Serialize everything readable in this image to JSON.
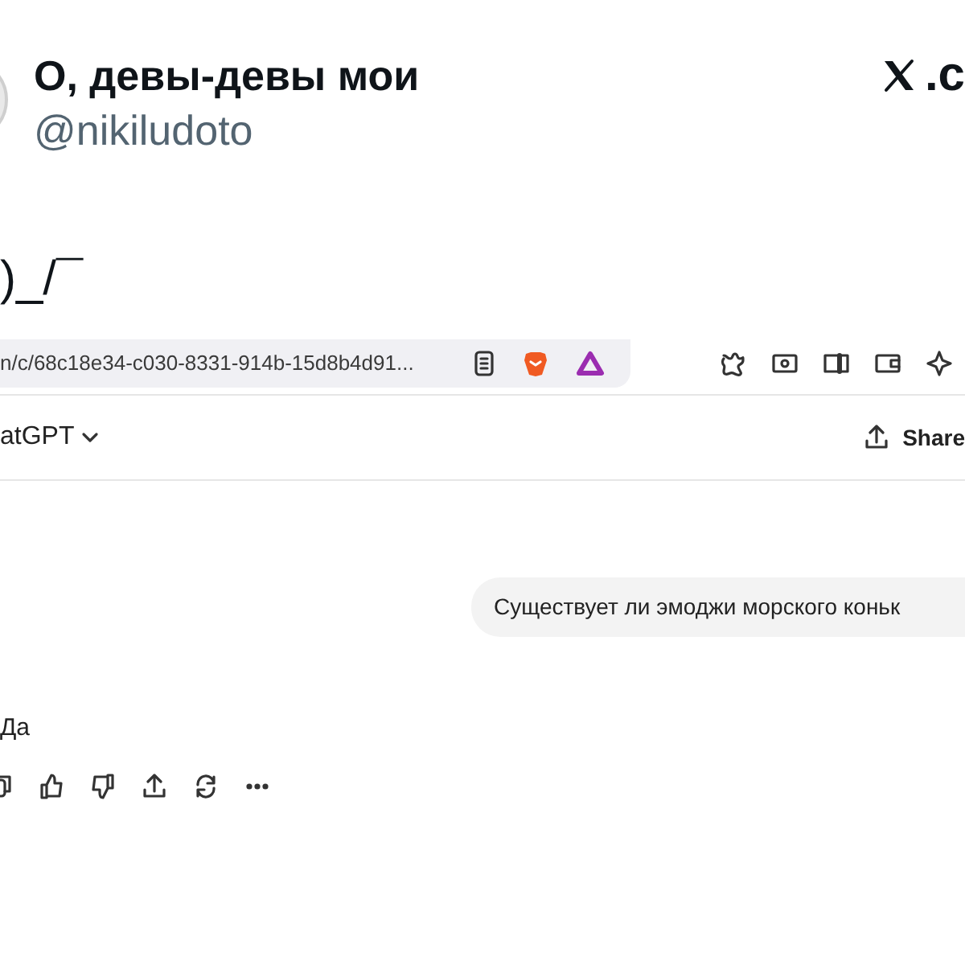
{
  "tweet": {
    "author_name": "О, девы-девы мои",
    "handle": "@nikiludoto",
    "site_label": ".c",
    "text": ")_/¯"
  },
  "screenshot": {
    "url": "n/c/68c18e34-c030-8331-914b-15d8b4d91...",
    "model_label": "atGPT",
    "share_label": "Share",
    "messages": [
      {
        "kind": "user",
        "text": "Существует ли эмоджи морского коньк"
      },
      {
        "kind": "assistant",
        "text": "Да"
      }
    ]
  }
}
